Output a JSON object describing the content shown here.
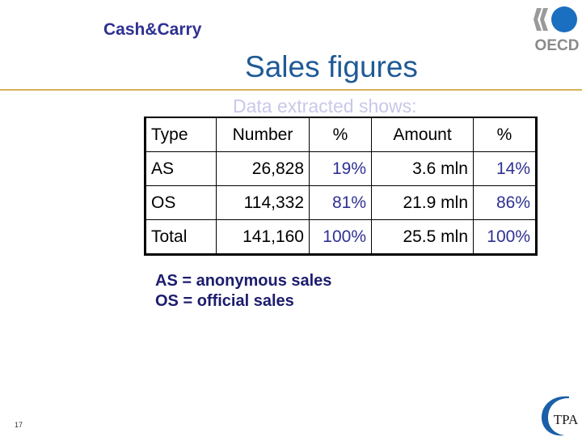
{
  "header": {
    "brand": "Cash&Carry",
    "logo_right": "OECD",
    "title": "Sales figures",
    "subtitle": "Data extracted shows:"
  },
  "colors": {
    "brand": "#2e3192",
    "title": "#1f5a96",
    "rule": "#d8b25a",
    "subtitle": "#c8c8ea",
    "percent_text": "#2e3192",
    "legend": "#1c1c6e",
    "oecd_blue": "#1a6fc0",
    "oecd_gray": "#8a8a8a"
  },
  "table": {
    "headers": [
      "Type",
      "Number",
      "%",
      "Amount",
      "%"
    ],
    "rows": [
      {
        "type": "AS",
        "number": "26,828",
        "number_pct": "19%",
        "amount": "3.6 mln",
        "amount_pct": "14%"
      },
      {
        "type": "OS",
        "number": "114,332",
        "number_pct": "81%",
        "amount": "21.9 mln",
        "amount_pct": "86%"
      },
      {
        "type": "Total",
        "number": "141,160",
        "number_pct": "100%",
        "amount": "25.5 mln",
        "amount_pct": "100%"
      }
    ]
  },
  "legend": {
    "line1": "AS = anonymous sales",
    "line2": "OS = official sales"
  },
  "footer": {
    "page_number": "17",
    "logo_text": "TPA"
  }
}
